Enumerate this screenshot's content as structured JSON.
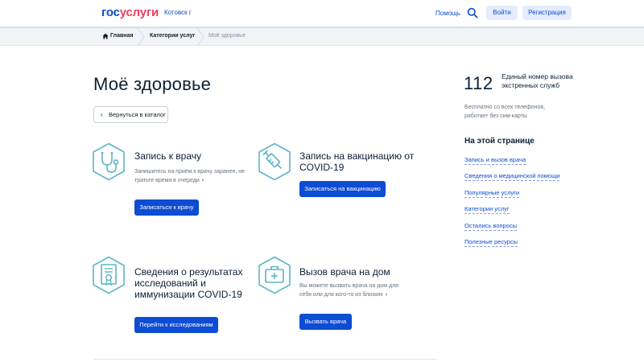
{
  "header": {
    "logo_part1": "гос",
    "logo_part2": "услуги",
    "city": "Котовск г",
    "help": "Помощь",
    "login": "Войти",
    "register": "Регистрация"
  },
  "breadcrumbs": {
    "home": "Главная",
    "categories": "Категории услуг",
    "current": "Моё здоровье"
  },
  "main": {
    "title": "Моё здоровье",
    "back": "Вернуться в каталог",
    "cards": [
      {
        "icon": "stethoscope-icon",
        "title": "Запись к врачу",
        "desc": "Запишитесь на приём к врачу заранее, не тратьте время в очереди",
        "button": "Записаться к врачу"
      },
      {
        "icon": "syringe-icon",
        "title": "Запись на вакцинацию от COVID-19",
        "desc": "",
        "button": "Записаться на вакцинацию"
      },
      {
        "icon": "certificate-icon",
        "title": "Сведения о результатах исследований и иммунизации COVID-19",
        "desc": "",
        "button": "Перейти к исследованиям"
      },
      {
        "icon": "medical-kit-icon",
        "title": "Вызов врача на дом",
        "desc": "Вы можете вызвать врача на дом для себя или для кого-то из близких",
        "button": "Вызвать врача"
      }
    ]
  },
  "sidebar": {
    "number": "112",
    "number_text": "Единый номер вызова экстренных служб",
    "number_note": "Бесплатно со всех телефонов, работает без сим-карты",
    "on_page_title": "На этой странице",
    "links": [
      "Запись и вызов врача",
      "Сведения о медицинской помощи",
      "Популярные услуги",
      "Категории услуг",
      "Остались вопросы",
      "Полезные ресурсы"
    ]
  },
  "colors": {
    "primary": "#0d4cd3",
    "logo_red": "#ee3f58",
    "icon_teal": "#5bb5c7",
    "text": "#0b1f33",
    "muted": "#66727f"
  }
}
